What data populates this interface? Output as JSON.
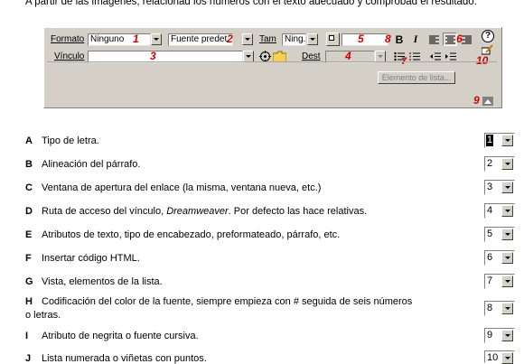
{
  "instructions": "A partir de las imágenes, relacionad los números con el texto adecuado y comprobad el resultado.",
  "panel": {
    "format_label": "Formato",
    "format_value": "Ninguno",
    "font_value": "Fuente predet.",
    "size_label": "Tam",
    "size_value": "Ning.",
    "link_label": "Vínculo",
    "target_label": "Dest",
    "list_element_button": "Elemento de lista...",
    "bold": "B",
    "italic": "I",
    "help": "?",
    "markers": [
      "1",
      "2",
      "3",
      "4",
      "5",
      "6",
      "7",
      "8",
      "9",
      "10"
    ]
  },
  "items": [
    {
      "letter": "A",
      "text": "Tipo de letra.",
      "value": "1"
    },
    {
      "letter": "B",
      "text": "Alineación del párrafo.",
      "value": "2"
    },
    {
      "letter": "C",
      "text": "Ventana de apertura del enlace (la misma, ventana nueva, etc.)",
      "value": "3"
    },
    {
      "letter": "D",
      "text_pre": "Ruta de acceso del vínculo, ",
      "text_em": "Dreamweaver",
      "text_post": ". Por defecto las hace relativas.",
      "value": "4"
    },
    {
      "letter": "E",
      "text": "Atributos de texto, tipo de encabezado, preformateado, párrafo, etc.",
      "value": "5"
    },
    {
      "letter": "F",
      "text": "Insertar código HTML.",
      "value": "6"
    },
    {
      "letter": "G",
      "text": "Vista, elementos de la lista.",
      "value": "7"
    },
    {
      "letter": "H",
      "text_line1": "Codificación del color de la fuente, siempre empieza con # seguida de seis números",
      "text_line2": "o letras.",
      "value": "8"
    },
    {
      "letter": "I",
      "text": "Atributo de negrita o fuente cursiva.",
      "value": "9"
    },
    {
      "letter": "J",
      "text": "Lista numerada o viñetas con puntos.",
      "value": "10"
    }
  ]
}
